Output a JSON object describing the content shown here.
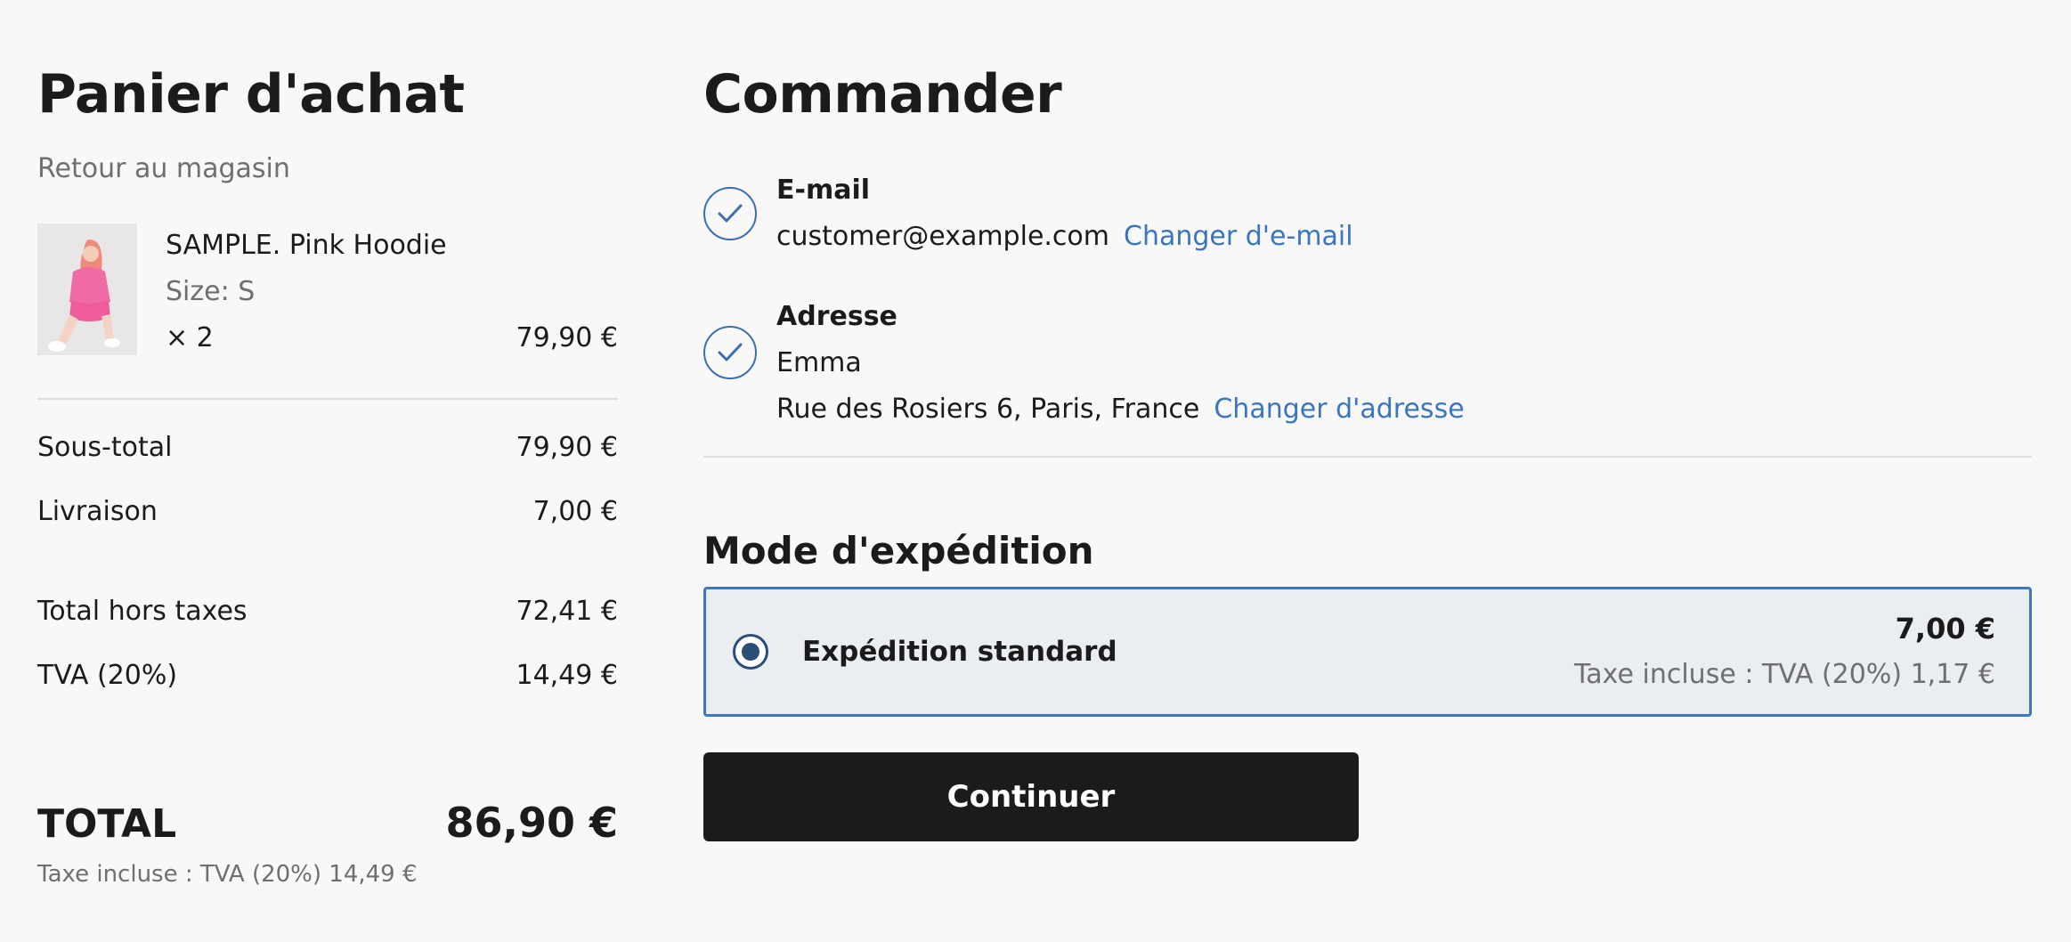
{
  "cart": {
    "title": "Panier d'achat",
    "back_link": "Retour au magasin",
    "item": {
      "name": "SAMPLE. Pink Hoodie",
      "size": "Size: S",
      "quantity": "× 2",
      "price": "79,90 €"
    },
    "subtotal_label": "Sous-total",
    "subtotal_value": "79,90 €",
    "shipping_label": "Livraison",
    "shipping_value": "7,00 €",
    "pretax_label": "Total hors taxes",
    "pretax_value": "72,41 €",
    "vat_label": "TVA (20%)",
    "vat_value": "14,49 €",
    "total_label": "TOTAL",
    "total_value": "86,90 €",
    "tax_note": "Taxe incluse : TVA (20%) 14,49 €"
  },
  "checkout": {
    "title": "Commander",
    "email": {
      "label": "E-mail",
      "value": "customer@example.com",
      "change_link": "Changer d'e-mail"
    },
    "address": {
      "label": "Adresse",
      "name": "Emma",
      "line": "Rue des Rosiers 6, Paris, France",
      "change_link": "Changer d'adresse"
    },
    "shipping": {
      "title": "Mode d'expédition",
      "option_name": "Expédition standard",
      "option_price": "7,00 €",
      "option_tax": "Taxe incluse : TVA (20%) 1,17 €",
      "selected": true
    },
    "continue_label": "Continuer"
  },
  "colors": {
    "accent": "#3b74bf",
    "button": "#1b1b1b",
    "selected_bg": "#eaedf2",
    "muted": "#6f6f6f"
  },
  "icons": [
    "check-icon",
    "radio-selected-icon",
    "product-thumbnail"
  ]
}
